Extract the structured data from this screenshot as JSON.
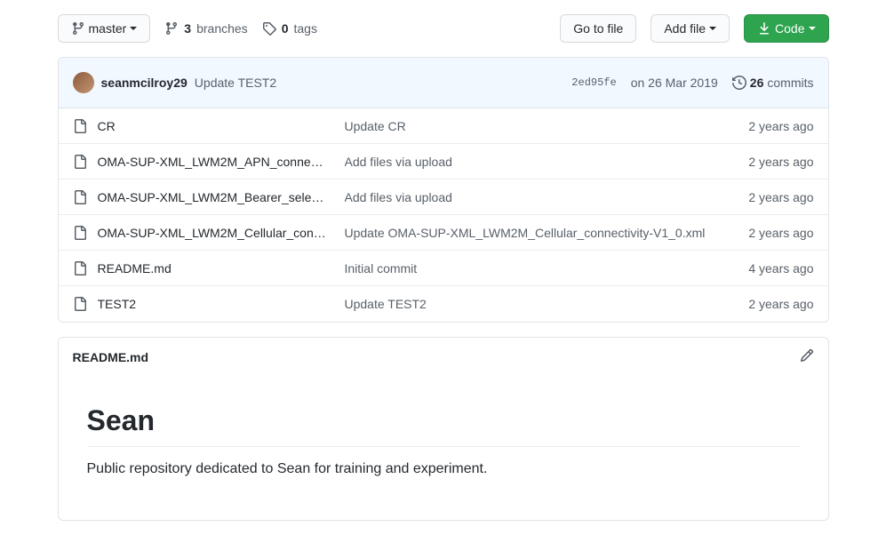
{
  "branch": {
    "name": "master"
  },
  "stats": {
    "branches_count": "3",
    "branches_label": "branches",
    "tags_count": "0",
    "tags_label": "tags"
  },
  "actions": {
    "go_to_file": "Go to file",
    "add_file": "Add file",
    "code": "Code"
  },
  "latest_commit": {
    "author": "seanmcilroy29",
    "message": "Update TEST2",
    "sha": "2ed95fe",
    "date": "on 26 Mar 2019",
    "commits_count": "26",
    "commits_label": "commits"
  },
  "files": [
    {
      "name": "CR",
      "msg": "Update CR",
      "age": "2 years ago"
    },
    {
      "name": "OMA-SUP-XML_LWM2M_APN_conne…",
      "msg": "Add files via upload",
      "age": "2 years ago"
    },
    {
      "name": "OMA-SUP-XML_LWM2M_Bearer_sele…",
      "msg": "Add files via upload",
      "age": "2 years ago"
    },
    {
      "name": "OMA-SUP-XML_LWM2M_Cellular_con…",
      "msg": "Update OMA-SUP-XML_LWM2M_Cellular_connectivity-V1_0.xml",
      "age": "2 years ago"
    },
    {
      "name": "README.md",
      "msg": "Initial commit",
      "age": "4 years ago"
    },
    {
      "name": "TEST2",
      "msg": "Update TEST2",
      "age": "2 years ago"
    }
  ],
  "readme": {
    "filename": "README.md",
    "title": "Sean",
    "body": "Public repository dedicated to Sean for training and experiment."
  }
}
